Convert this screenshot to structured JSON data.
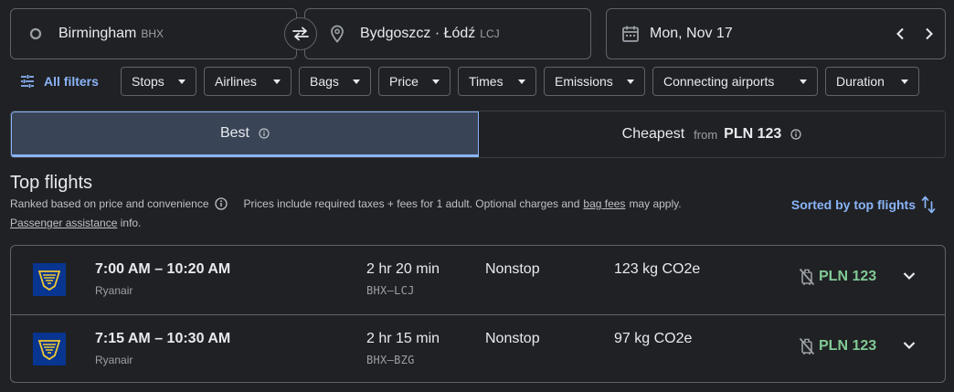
{
  "search": {
    "origin": {
      "city": "Birmingham",
      "code": "BHX"
    },
    "destination": {
      "city": "Bydgoszcz · Łódź",
      "code": "LCJ"
    },
    "date": "Mon, Nov 17"
  },
  "filters": {
    "all_label": "All filters",
    "chips": [
      "Stops",
      "Airlines",
      "Bags",
      "Price",
      "Times",
      "Emissions",
      "Connecting airports",
      "Duration"
    ]
  },
  "tabs": {
    "best_label": "Best",
    "cheapest_label": "Cheapest",
    "cheapest_from": "from",
    "cheapest_price": "PLN 123"
  },
  "results": {
    "heading": "Top flights",
    "ranked_text": "Ranked based on price and convenience",
    "prices_text_a": "Prices include required taxes + fees for 1 adult. Optional charges and",
    "bag_fees_link": "bag fees",
    "prices_text_b": "may apply.",
    "assistance_link": "Passenger assistance",
    "assistance_suffix": "info.",
    "sorted_label": "Sorted by top flights"
  },
  "flights": [
    {
      "times": "7:00 AM – 10:20 AM",
      "airline": "Ryanair",
      "duration": "2 hr 20 min",
      "route": "BHX–LCJ",
      "stops": "Nonstop",
      "emissions": "123 kg CO2e",
      "price": "PLN 123"
    },
    {
      "times": "7:15 AM – 10:30 AM",
      "airline": "Ryanair",
      "duration": "2 hr 15 min",
      "route": "BHX–BZG",
      "stops": "Nonstop",
      "emissions": "97 kg CO2e",
      "price": "PLN 123"
    }
  ],
  "colors": {
    "background": "#202124",
    "accent": "#8ab4f8",
    "price_green": "#81c995",
    "ryanair_blue": "#073590",
    "ryanair_yellow": "#f1c933"
  },
  "icons": [
    "origin-circle-icon",
    "swap-icon",
    "location-pin-icon",
    "calendar-icon",
    "chevron-left-icon",
    "chevron-right-icon",
    "filter-tune-icon",
    "info-icon",
    "sort-icon",
    "ryanair-logo",
    "no-carry-on-bag-icon",
    "expand-chevron-icon"
  ]
}
